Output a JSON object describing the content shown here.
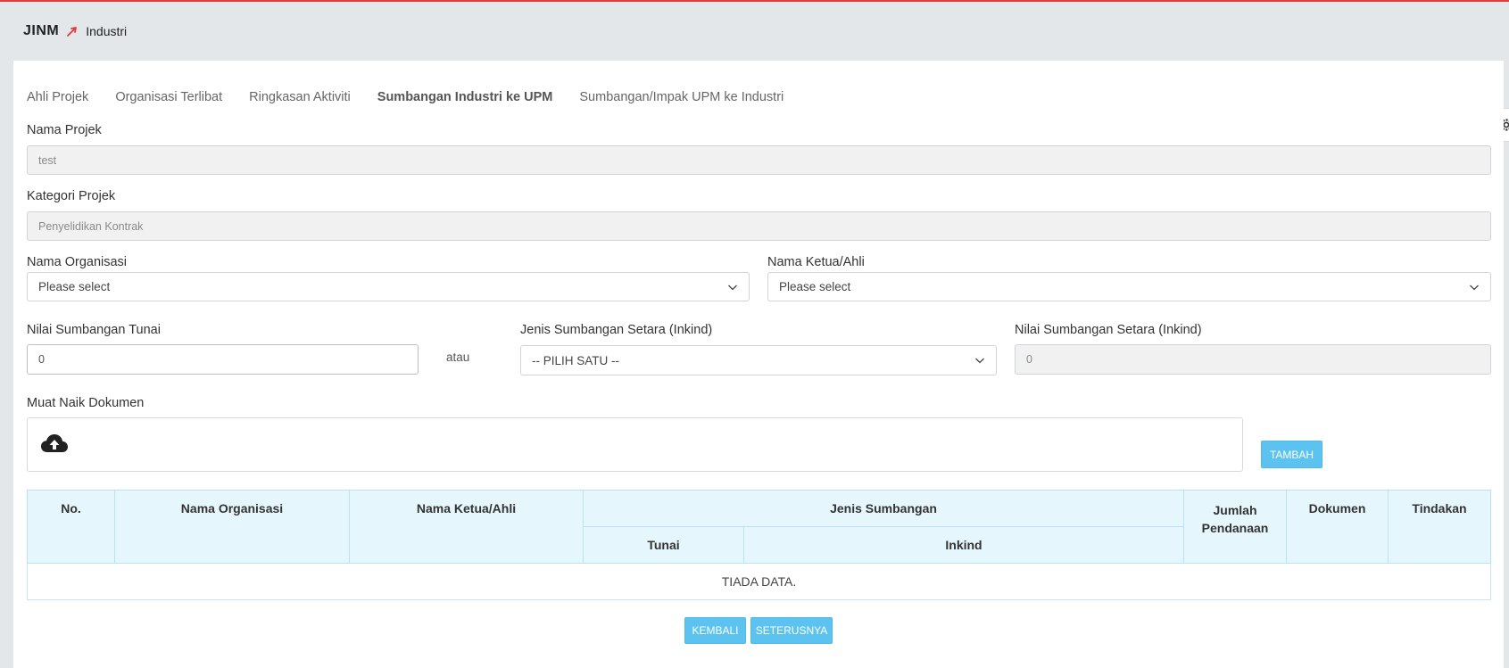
{
  "brand": {
    "logo": "JINM",
    "subtitle": "Industri"
  },
  "tabs": [
    {
      "label": "Ahli Projek",
      "active": false
    },
    {
      "label": "Organisasi Terlibat",
      "active": false
    },
    {
      "label": "Ringkasan Aktiviti",
      "active": false
    },
    {
      "label": "Sumbangan Industri ke UPM",
      "active": true
    },
    {
      "label": "Sumbangan/Impak UPM ke Industri",
      "active": false
    }
  ],
  "form": {
    "nama_projek": {
      "label": "Nama Projek",
      "value": "test"
    },
    "kategori_projek": {
      "label": "Kategori Projek",
      "value": "Penyelidikan Kontrak"
    },
    "nama_organisasi": {
      "label": "Nama Organisasi",
      "value": "Please select"
    },
    "nama_ketua": {
      "label": "Nama Ketua/Ahli",
      "value": "Please select"
    },
    "nilai_tunai": {
      "label": "Nilai Sumbangan Tunai",
      "value": "0"
    },
    "atau": "atau",
    "jenis_inkind": {
      "label": "Jenis Sumbangan Setara (Inkind)",
      "value": "-- PILIH SATU --"
    },
    "nilai_inkind": {
      "label": "Nilai Sumbangan Setara (Inkind)",
      "value": "0"
    },
    "muat_naik": {
      "label": "Muat Naik Dokumen"
    },
    "tambah_label": "TAMBAH"
  },
  "table": {
    "headers": {
      "no": "No.",
      "nama_organisasi": "Nama Organisasi",
      "nama_ketua": "Nama Ketua/Ahli",
      "jenis_sumbangan": "Jenis Sumbangan",
      "tunai": "Tunai",
      "inkind": "Inkind",
      "jumlah": "Jumlah Pendanaan",
      "dokumen": "Dokumen",
      "tindakan": "Tindakan"
    },
    "empty_text": "TIADA DATA."
  },
  "buttons": {
    "kembali": "KEMBALI",
    "seterusnya": "SETERUSNYA"
  },
  "colors": {
    "accent": "#e03a3a",
    "button": "#5cc3f1",
    "table_header": "#e5f6fd"
  }
}
